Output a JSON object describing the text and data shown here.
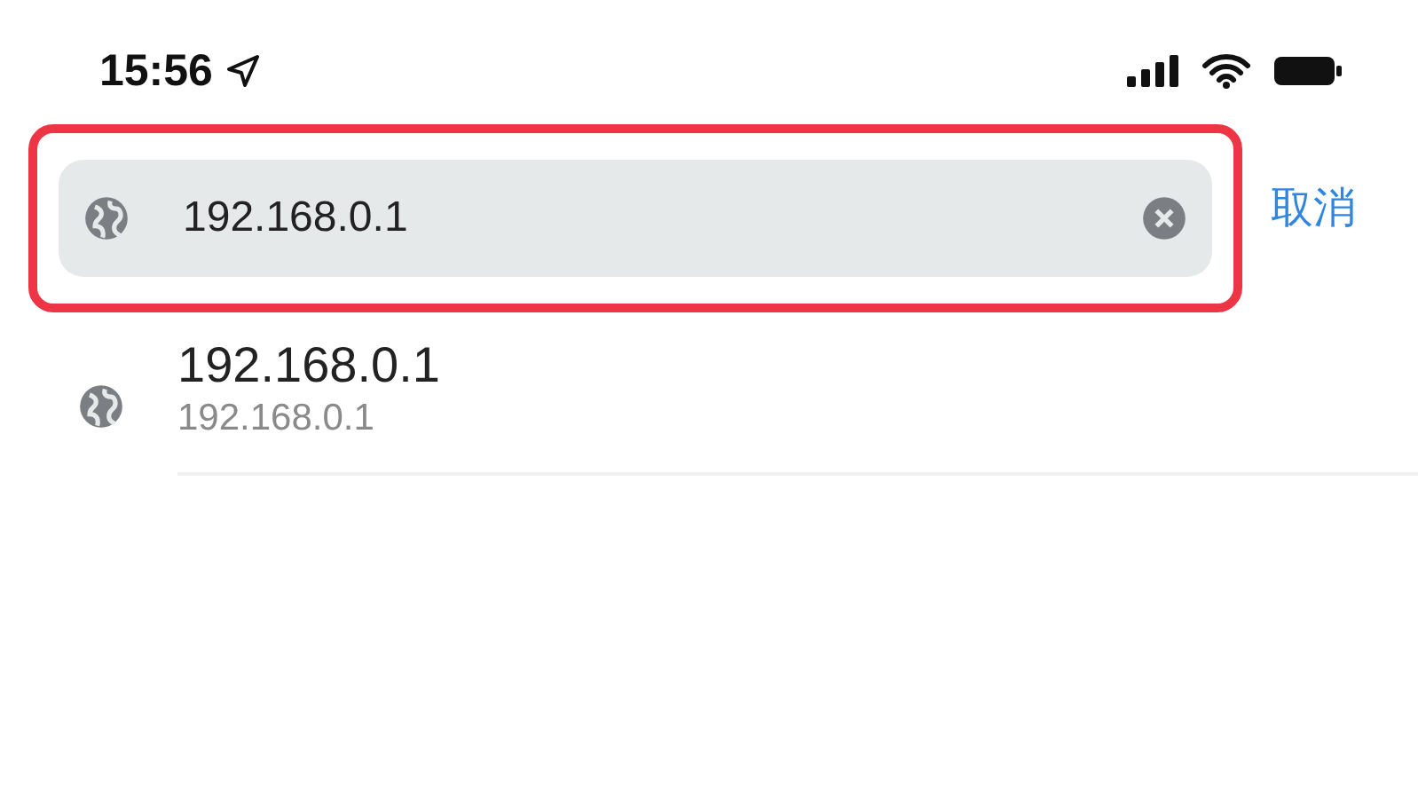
{
  "status_bar": {
    "time": "15:56"
  },
  "address_bar": {
    "value": "192.168.0.1",
    "highlighted": true,
    "cancel_label": "取消"
  },
  "suggestions": [
    {
      "title": "192.168.0.1",
      "subtitle": "192.168.0.1"
    }
  ]
}
